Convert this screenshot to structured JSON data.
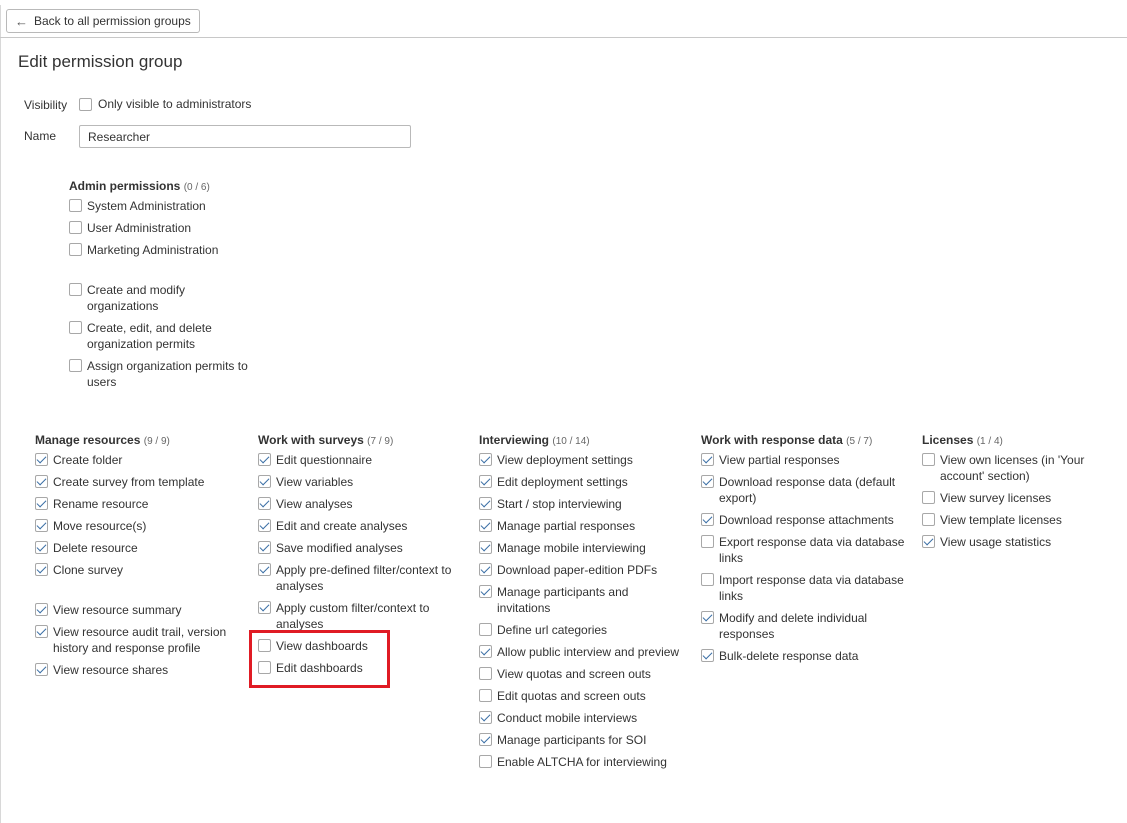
{
  "topbar": {
    "back_label": "Back to all permission groups"
  },
  "page": {
    "title": "Edit permission group"
  },
  "form": {
    "visibility_label": "Visibility",
    "visibility_option": "Only visible to administrators",
    "name_label": "Name",
    "name_value": "Researcher"
  },
  "admin": {
    "heading": "Admin permissions",
    "count": "(0 / 6)",
    "items": [
      {
        "label": "System Administration",
        "checked": false
      },
      {
        "label": "User Administration",
        "checked": false
      },
      {
        "label": "Marketing Administration",
        "checked": false
      },
      {
        "label": "Create and modify organizations",
        "checked": false
      },
      {
        "label": "Create, edit, and delete organization permits",
        "checked": false
      },
      {
        "label": "Assign organization permits to users",
        "checked": false
      }
    ]
  },
  "groups": [
    {
      "heading": "Manage resources",
      "count": "(9 / 9)",
      "items": [
        {
          "label": "Create folder",
          "checked": true
        },
        {
          "label": "Create survey from template",
          "checked": true
        },
        {
          "label": "Rename resource",
          "checked": true
        },
        {
          "label": "Move resource(s)",
          "checked": true
        },
        {
          "label": "Delete resource",
          "checked": true
        },
        {
          "label": "Clone survey",
          "checked": true
        },
        {
          "label": "View resource summary",
          "checked": true
        },
        {
          "label": "View resource audit trail, version history and response profile",
          "checked": true
        },
        {
          "label": "View resource shares",
          "checked": true
        }
      ]
    },
    {
      "heading": "Work with surveys",
      "count": "(7 / 9)",
      "items": [
        {
          "label": "Edit questionnaire",
          "checked": true
        },
        {
          "label": "View variables",
          "checked": true
        },
        {
          "label": "View analyses",
          "checked": true
        },
        {
          "label": "Edit and create analyses",
          "checked": true
        },
        {
          "label": "Save modified analyses",
          "checked": true
        },
        {
          "label": "Apply pre-defined filter/context to analyses",
          "checked": true
        },
        {
          "label": "Apply custom filter/context to analyses",
          "checked": true
        },
        {
          "label": "View dashboards",
          "checked": false
        },
        {
          "label": "Edit dashboards",
          "checked": false
        }
      ]
    },
    {
      "heading": "Interviewing",
      "count": "(10 / 14)",
      "items": [
        {
          "label": "View deployment settings",
          "checked": true
        },
        {
          "label": "Edit deployment settings",
          "checked": true
        },
        {
          "label": "Start / stop interviewing",
          "checked": true
        },
        {
          "label": "Manage partial responses",
          "checked": true
        },
        {
          "label": "Manage mobile interviewing",
          "checked": true
        },
        {
          "label": "Download paper-edition PDFs",
          "checked": true
        },
        {
          "label": "Manage participants and invitations",
          "checked": true
        },
        {
          "label": "Define url categories",
          "checked": false
        },
        {
          "label": "Allow public interview and preview",
          "checked": true
        },
        {
          "label": "View quotas and screen outs",
          "checked": false
        },
        {
          "label": "Edit quotas and screen outs",
          "checked": false
        },
        {
          "label": "Conduct mobile interviews",
          "checked": true
        },
        {
          "label": "Manage participants for SOI",
          "checked": true
        },
        {
          "label": "Enable ALTCHA for interviewing",
          "checked": false
        }
      ]
    },
    {
      "heading": "Work with response data",
      "count": "(5 / 7)",
      "items": [
        {
          "label": "View partial responses",
          "checked": true
        },
        {
          "label": "Download response data (default export)",
          "checked": true
        },
        {
          "label": "Download response attachments",
          "checked": true
        },
        {
          "label": "Export response data via database links",
          "checked": false
        },
        {
          "label": "Import response data via database links",
          "checked": false
        },
        {
          "label": "Modify and delete individual responses",
          "checked": true
        },
        {
          "label": "Bulk-delete response data",
          "checked": true
        }
      ]
    },
    {
      "heading": "Licenses",
      "count": "(1 / 4)",
      "items": [
        {
          "label": "View own licenses (in 'Your account' section)",
          "checked": false
        },
        {
          "label": "View survey licenses",
          "checked": false
        },
        {
          "label": "View template licenses",
          "checked": false
        },
        {
          "label": "View usage statistics",
          "checked": true
        }
      ]
    }
  ]
}
